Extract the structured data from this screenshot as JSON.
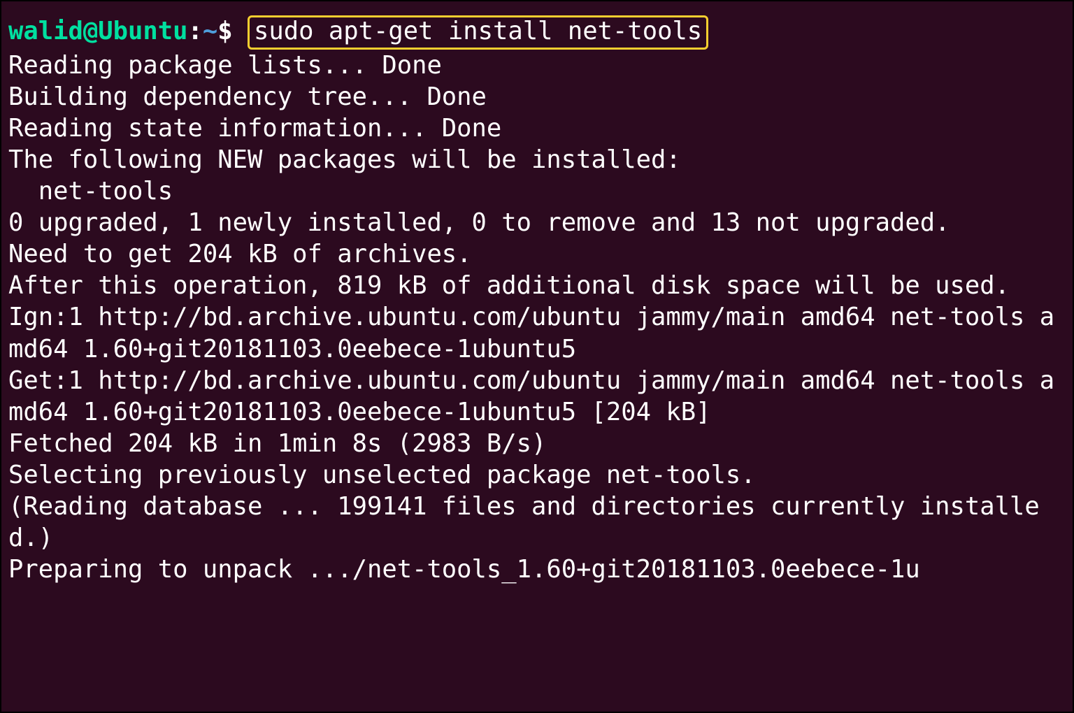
{
  "prompt": {
    "user": "walid",
    "at": "@",
    "host": "Ubuntu",
    "colon": ":",
    "path": "~",
    "dollar": "$"
  },
  "command": "sudo apt-get install net-tools",
  "output_lines": [
    "Reading package lists... Done",
    "Building dependency tree... Done",
    "Reading state information... Done",
    "The following NEW packages will be installed:",
    "  net-tools",
    "0 upgraded, 1 newly installed, 0 to remove and 13 not upgraded.",
    "Need to get 204 kB of archives.",
    "After this operation, 819 kB of additional disk space will be used.",
    "Ign:1 http://bd.archive.ubuntu.com/ubuntu jammy/main amd64 net-tools amd64 1.60+git20181103.0eebece-1ubuntu5",
    "Get:1 http://bd.archive.ubuntu.com/ubuntu jammy/main amd64 net-tools amd64 1.60+git20181103.0eebece-1ubuntu5 [204 kB]",
    "Fetched 204 kB in 1min 8s (2983 B/s)",
    "Selecting previously unselected package net-tools.",
    "(Reading database ... 199141 files and directories currently installed.)",
    "Preparing to unpack .../net-tools_1.60+git20181103.0eebece-1u"
  ]
}
